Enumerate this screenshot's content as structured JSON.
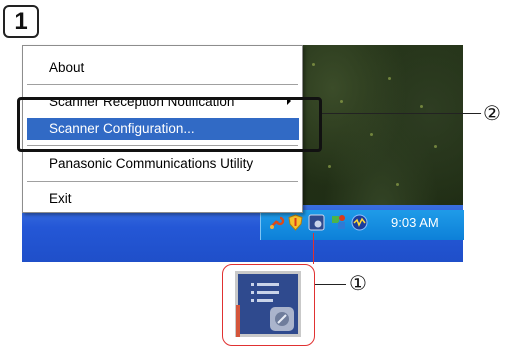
{
  "step_number": "1",
  "menu": {
    "items": [
      {
        "label": "About"
      },
      {
        "label": "Scanner Reception Notification"
      },
      {
        "label": "Scanner Configuration..."
      },
      {
        "label": "Panasonic Communications Utility"
      },
      {
        "label": "Exit"
      }
    ]
  },
  "taskbar": {
    "clock": "9:03 AM",
    "tray_icons": [
      "wrench-icon",
      "shield-icon",
      "scanner-utility-icon",
      "network-icon",
      "audio-icon"
    ]
  },
  "callouts": {
    "one": "①",
    "two": "②"
  },
  "colors": {
    "highlight": "#316ac5",
    "taskbar": "#2457d6",
    "tray": "#0d80d8",
    "zoom_border": "#e03131"
  }
}
